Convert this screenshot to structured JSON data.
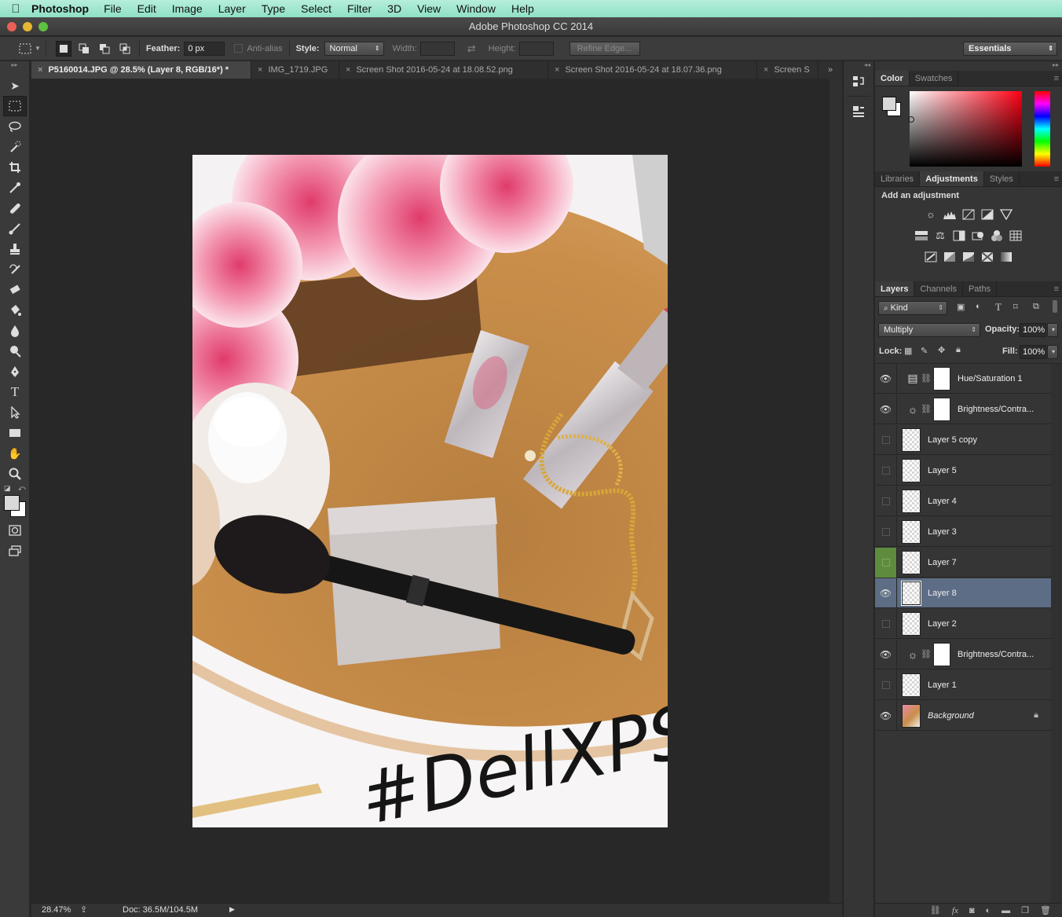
{
  "menubar": {
    "app": "Photoshop",
    "items": [
      "File",
      "Edit",
      "Image",
      "Layer",
      "Type",
      "Select",
      "Filter",
      "3D",
      "View",
      "Window",
      "Help"
    ]
  },
  "window": {
    "title": "Adobe Photoshop CC 2014"
  },
  "options": {
    "feather_label": "Feather:",
    "feather_value": "0 px",
    "antialias_label": "Anti-alias",
    "style_label": "Style:",
    "style_value": "Normal",
    "width_label": "Width:",
    "height_label": "Height:",
    "refine_edge": "Refine Edge...",
    "workspace": "Essentials"
  },
  "tabs": [
    {
      "label": "P5160014.JPG @ 28.5% (Layer 8, RGB/16*) *",
      "active": true
    },
    {
      "label": "IMG_1719.JPG",
      "active": false
    },
    {
      "label": "Screen Shot 2016-05-24 at 18.08.52.png",
      "active": false
    },
    {
      "label": "Screen Shot 2016-05-24 at 18.07.36.png",
      "active": false
    },
    {
      "label": "Screen S",
      "active": false
    }
  ],
  "canvas": {
    "overlay_text": "#DellXPS"
  },
  "status": {
    "zoom": "28.47%",
    "doc": "Doc: 36.5M/104.5M"
  },
  "color_panel": {
    "tabs": [
      "Color",
      "Swatches"
    ]
  },
  "adjustments_panel": {
    "tabs": [
      "Libraries",
      "Adjustments",
      "Styles"
    ],
    "heading": "Add an adjustment"
  },
  "layers_panel": {
    "tabs": [
      "Layers",
      "Channels",
      "Paths"
    ],
    "filter_kind": "Kind",
    "blend_mode": "Multiply",
    "opacity_label": "Opacity:",
    "opacity": "100%",
    "lock_label": "Lock:",
    "fill_label": "Fill:",
    "fill": "100%",
    "layers": [
      {
        "name": "Hue/Saturation 1",
        "visible": true,
        "type": "adjustment",
        "icon": "hue-saturation-icon"
      },
      {
        "name": "Brightness/Contra...",
        "visible": true,
        "type": "adjustment",
        "icon": "brightness-contrast-icon"
      },
      {
        "name": "Layer 5 copy",
        "visible": false,
        "type": "pixel"
      },
      {
        "name": "Layer 5",
        "visible": false,
        "type": "pixel"
      },
      {
        "name": "Layer 4",
        "visible": false,
        "type": "pixel"
      },
      {
        "name": "Layer 3",
        "visible": false,
        "type": "pixel"
      },
      {
        "name": "Layer 7",
        "visible": false,
        "type": "pixel",
        "color_label": "#5e8c3c"
      },
      {
        "name": "Layer 8",
        "visible": true,
        "type": "pixel",
        "selected": true
      },
      {
        "name": "Layer 2",
        "visible": false,
        "type": "pixel"
      },
      {
        "name": "Brightness/Contra...",
        "visible": true,
        "type": "adjustment",
        "icon": "brightness-contrast-icon"
      },
      {
        "name": "Layer 1",
        "visible": false,
        "type": "pixel"
      },
      {
        "name": "Background",
        "visible": true,
        "type": "background",
        "locked": true
      }
    ]
  },
  "colors": {
    "accent_selected_layer": "#5c6d85",
    "label_green": "#5e8c3c"
  }
}
